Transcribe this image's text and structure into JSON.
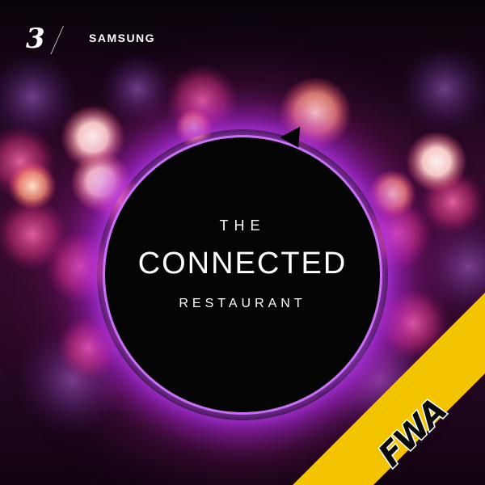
{
  "brand": {
    "three_logo": "3",
    "samsung_logo": "SAMSUNG",
    "fwa_logo": "FWA",
    "ribbon_color": "#f3c300"
  },
  "headline": {
    "pre": "THE",
    "main": "CONNECTED",
    "post": "RESTAURANT"
  },
  "colors": {
    "accent_glow": "#b43cf0",
    "circle": "#050505"
  },
  "icons": {
    "background": "bokeh-lights-icon",
    "ribbon": "corner-ribbon-icon"
  }
}
